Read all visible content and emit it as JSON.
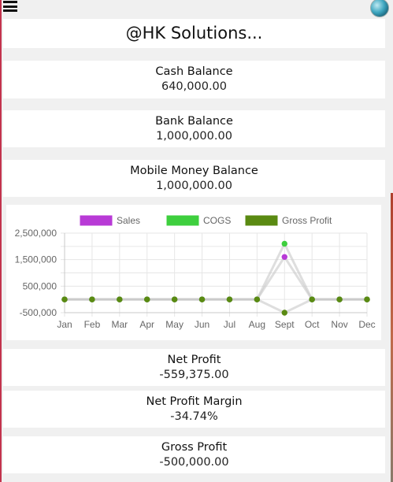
{
  "app": {
    "title": "@HK Solutions..."
  },
  "colors": {
    "frame": "#c2334d",
    "sales": "#b83ad6",
    "cogs": "#3ecf3e",
    "gross_profit": "#5a8a12"
  },
  "icons": {
    "menu": "hamburger-menu-icon",
    "avatar": "user-avatar"
  },
  "stats": {
    "cash": {
      "label": "Cash Balance",
      "value": "640,000.00"
    },
    "bank": {
      "label": "Bank Balance",
      "value": "1,000,000.00"
    },
    "mobile": {
      "label": "Mobile Money Balance",
      "value": "1,000,000.00"
    },
    "net_profit": {
      "label": "Net Profit",
      "value": "-559,375.00"
    },
    "net_margin": {
      "label": "Net Profit Margin",
      "value": "-34.74%"
    },
    "gross_profit": {
      "label": "Gross Profit",
      "value": "-500,000.00"
    }
  },
  "chart_data": {
    "type": "line",
    "categories": [
      "Jan",
      "Feb",
      "Mar",
      "Apr",
      "May",
      "Jun",
      "Jul",
      "Aug",
      "Sept",
      "Oct",
      "Nov",
      "Dec"
    ],
    "series": [
      {
        "name": "Sales",
        "color": "#b83ad6",
        "values": [
          0,
          0,
          0,
          0,
          0,
          0,
          0,
          0,
          1600000,
          0,
          0,
          0
        ]
      },
      {
        "name": "COGS",
        "color": "#3ecf3e",
        "values": [
          0,
          0,
          0,
          0,
          0,
          0,
          0,
          0,
          2100000,
          0,
          0,
          0
        ]
      },
      {
        "name": "Gross Profit",
        "color": "#5a8a12",
        "values": [
          0,
          0,
          0,
          0,
          0,
          0,
          0,
          0,
          -500000,
          0,
          0,
          0
        ]
      }
    ],
    "yticks": [
      {
        "value": 2500000,
        "label": "2,500,000"
      },
      {
        "value": 1500000,
        "label": "1,500,000"
      },
      {
        "value": 500000,
        "label": "500,000"
      },
      {
        "value": -500000,
        "label": "-500,000"
      }
    ],
    "ylim": [
      -500000,
      2500000
    ],
    "grid": true,
    "legend_position": "top"
  }
}
